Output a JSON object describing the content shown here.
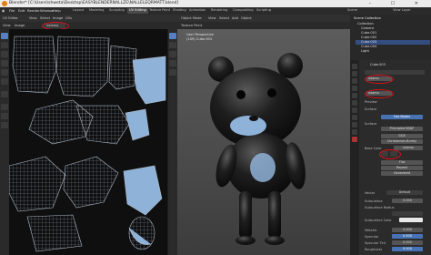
{
  "window": {
    "title": "Blender* [C:\\Users\\shweta\\Desktop\\EASYBLENDERNALLZE\\NALLELEQRMATT.blend]",
    "controls": "–  ☐  ✕"
  },
  "menubar": {
    "items": [
      "File",
      "Edit",
      "Render",
      "Window",
      "Help"
    ],
    "workspaces": [
      "Layout",
      "Modeling",
      "Sculpting",
      "UV Editing",
      "Texture Paint",
      "Shading",
      "Animation",
      "Rendering",
      "Compositing",
      "Scripting"
    ],
    "active_workspace": "UV Editing",
    "scene_label": "Scene",
    "view_layer_label": "View Layer"
  },
  "uv_editor": {
    "mode": "UV Editor",
    "menus": [
      "View",
      "Select",
      "Image",
      "UVs"
    ],
    "image_name": "nalamo",
    "sub_menus": [
      "View",
      "Image"
    ]
  },
  "viewport": {
    "mode": "Object Mode",
    "menus": [
      "View",
      "Select",
      "Add",
      "Object"
    ],
    "shading": "Texture Paint",
    "view_name": "User Perspective",
    "collection_info": "(109) Cube.003"
  },
  "outliner": {
    "title": "Scene Collection",
    "rows": [
      "Collection",
      "Camera",
      "Cube.001",
      "Cube.002",
      "Cube.003",
      "Cube.004",
      "Light"
    ]
  },
  "properties": {
    "object_name": "Cube.003",
    "material_name": "naamo",
    "preview_label": "Preview",
    "surface_label": "Surface",
    "use_nodes": "Use Nodes",
    "surface_shader_label": "Surface",
    "surface_shader": "Principled BSDF",
    "distribution": "GGX",
    "subsurface_method": "Christensen-Burley",
    "base_color_label": "Base Color",
    "base_color_value": "naamo",
    "interp": "Flat",
    "extension": "Repeat",
    "projection": "Generated",
    "vector_label": "Vector",
    "vector_value": "Default",
    "subsurface_label": "Subsurface",
    "subsurface_value": "0.000",
    "subsurface_radius_label": "Subsurface Radius",
    "subsurface_color_label": "Subsurface Color",
    "metallic_label": "Metallic",
    "metallic_value": "0.000",
    "specular_label": "Specular",
    "specular_value": "0.500",
    "specular_tint_label": "Specular Tint",
    "specular_tint_value": "0.000",
    "roughness_label": "Roughness",
    "roughness_value": "0.500"
  },
  "colors": {
    "accent": "#4772b3",
    "highlight": "#e0101a",
    "uv_mesh": "#9aa7bb",
    "uv_fill": "#8fb2d8"
  }
}
